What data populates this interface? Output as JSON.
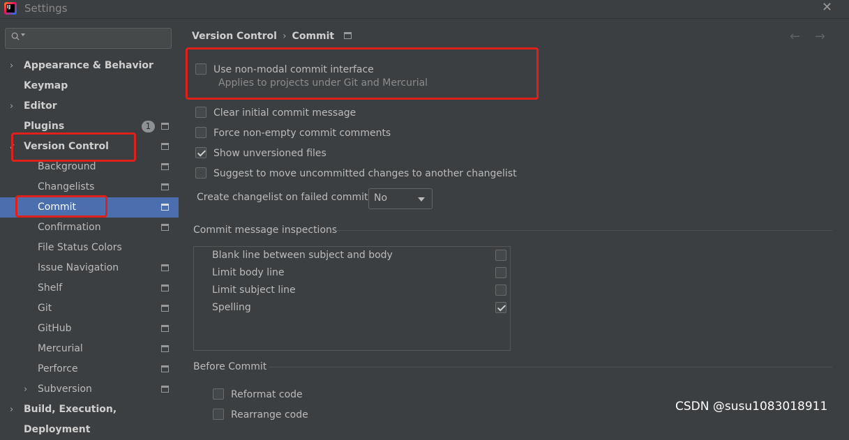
{
  "window": {
    "title": "Settings",
    "logo_text": "IJ"
  },
  "search": {
    "placeholder": ""
  },
  "sidebar": {
    "items": [
      {
        "label": "Appearance & Behavior",
        "level": 0,
        "arrow": "›"
      },
      {
        "label": "Keymap",
        "level": 0
      },
      {
        "label": "Editor",
        "level": 0,
        "arrow": "›"
      },
      {
        "label": "Plugins",
        "level": 0,
        "badge": "1"
      },
      {
        "label": "Version Control",
        "level": 0,
        "arrow": "✓"
      },
      {
        "label": "Background",
        "level": 1
      },
      {
        "label": "Changelists",
        "level": 1
      },
      {
        "label": "Commit",
        "level": 1,
        "selected": true
      },
      {
        "label": "Confirmation",
        "level": 1
      },
      {
        "label": "File Status Colors",
        "level": 1
      },
      {
        "label": "Issue Navigation",
        "level": 1
      },
      {
        "label": "Shelf",
        "level": 1
      },
      {
        "label": "Git",
        "level": 1
      },
      {
        "label": "GitHub",
        "level": 1
      },
      {
        "label": "Mercurial",
        "level": 1
      },
      {
        "label": "Perforce",
        "level": 1
      },
      {
        "label": "Subversion",
        "level": 1,
        "arrow": "›"
      },
      {
        "label": "Build, Execution, Deployment",
        "level": 0,
        "arrow": "›"
      }
    ]
  },
  "breadcrumb": {
    "parent": "Version Control",
    "separator": "›",
    "current": "Commit"
  },
  "nav": {
    "back": "←",
    "forward": "→"
  },
  "options": {
    "non_modal": {
      "label": "Use non-modal commit interface",
      "hint": "Applies to projects under Git and Mercurial",
      "checked": false
    },
    "clear_initial": {
      "label": "Clear initial commit message",
      "checked": false
    },
    "force_non_empty": {
      "label": "Force non-empty commit comments",
      "checked": false
    },
    "show_unversioned": {
      "label": "Show unversioned files",
      "checked": true
    },
    "suggest_move": {
      "label": "Suggest to move uncommitted changes to another changelist",
      "checked": false
    }
  },
  "changelist": {
    "label": "Create changelist on failed commit:",
    "value": "No"
  },
  "inspections": {
    "title": "Commit message inspections",
    "rows": [
      {
        "label": "Blank line between subject and body",
        "checked": false
      },
      {
        "label": "Limit body line",
        "checked": false
      },
      {
        "label": "Limit subject line",
        "checked": false
      },
      {
        "label": "Spelling",
        "checked": true
      }
    ]
  },
  "before_commit": {
    "title": "Before Commit",
    "reformat": {
      "label": "Reformat code",
      "checked": false
    },
    "rearrange": {
      "label": "Rearrange code",
      "checked": false
    }
  },
  "watermark": "CSDN @susu1083018911",
  "colors": {
    "background": "#3c3f41",
    "selection": "#4b6eaf",
    "highlight": "#e0211b"
  }
}
